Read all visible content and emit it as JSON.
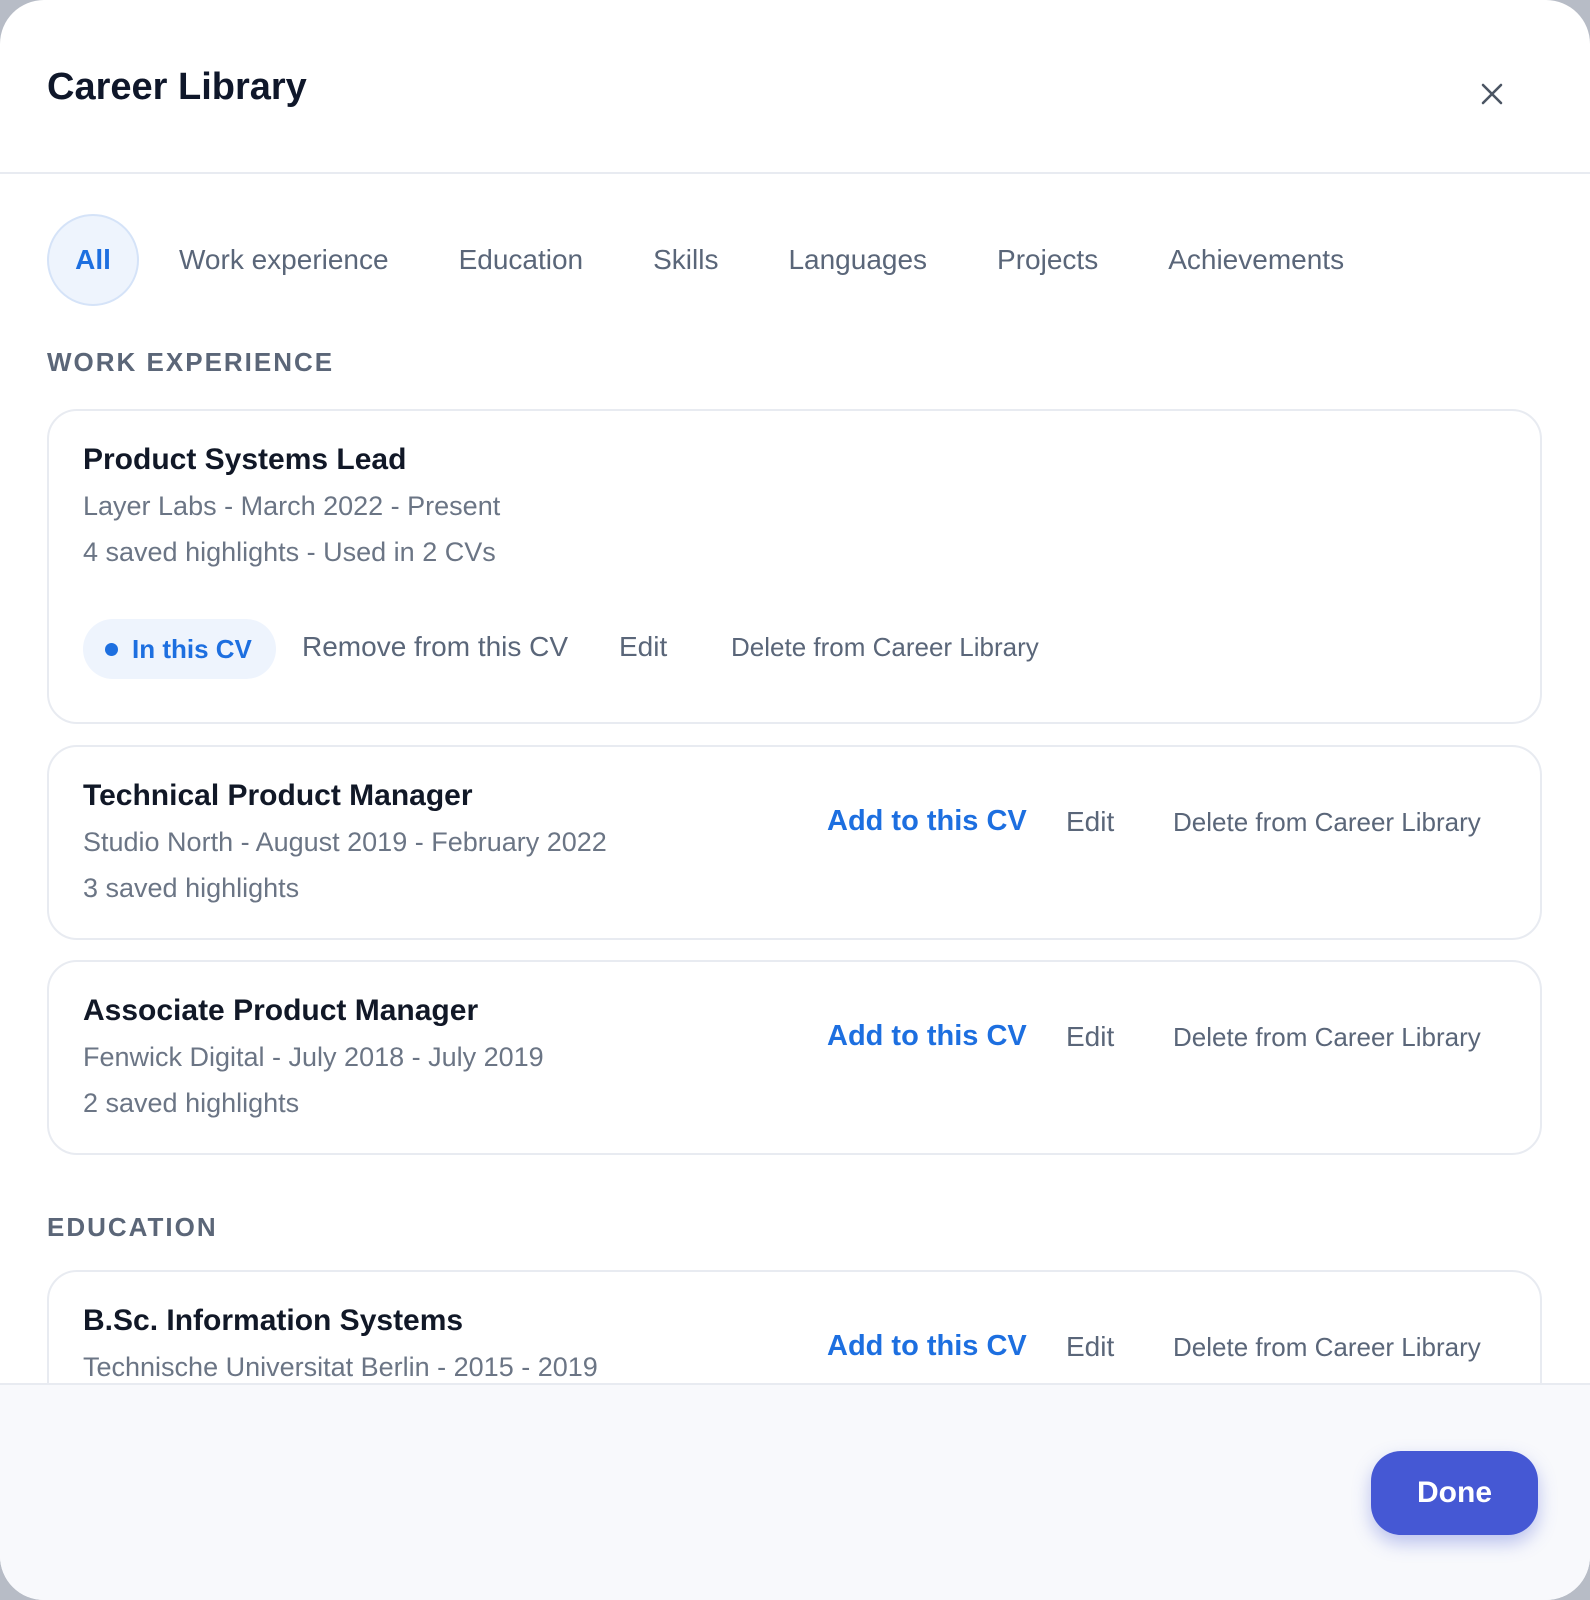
{
  "dialog": {
    "title": "Career Library",
    "close_icon": "close-icon"
  },
  "tabs": [
    {
      "label": "All",
      "active": true
    },
    {
      "label": "Work experience",
      "active": false
    },
    {
      "label": "Education",
      "active": false
    },
    {
      "label": "Skills",
      "active": false
    },
    {
      "label": "Languages",
      "active": false
    },
    {
      "label": "Projects",
      "active": false
    },
    {
      "label": "Achievements",
      "active": false
    }
  ],
  "work_experience": {
    "heading": "WORK EXPERIENCE",
    "items": [
      {
        "title": "Product Systems Lead",
        "subtitle": "Layer Labs - March 2022 - Present",
        "meta": "4 saved highlights - Used in 2 CVs",
        "status_label": "In this CV",
        "remove_label": "Remove from this CV",
        "edit_label": "Edit",
        "delete_label": "Delete from Career Library"
      },
      {
        "title": "Technical Product Manager",
        "subtitle": "Studio North - August 2019 - February 2022",
        "meta": "3 saved highlights",
        "add_label": "Add to this CV",
        "edit_label": "Edit",
        "delete_label": "Delete from Career Library"
      },
      {
        "title": "Associate Product Manager",
        "subtitle": "Fenwick Digital - July 2018 - July 2019",
        "meta": "2 saved highlights",
        "add_label": "Add to this CV",
        "edit_label": "Edit",
        "delete_label": "Delete from Career Library"
      }
    ]
  },
  "education": {
    "heading": "EDUCATION",
    "items": [
      {
        "title": "B.Sc. Information Systems",
        "subtitle": "Technische Universitat Berlin - 2015 - 2019",
        "add_label": "Add to this CV",
        "edit_label": "Edit",
        "delete_label": "Delete from Career Library"
      }
    ]
  },
  "footer": {
    "done_label": "Done"
  },
  "colors": {
    "accent": "#1d6fe0",
    "primary_button": "#4558d4",
    "muted_text": "#5a6679"
  }
}
